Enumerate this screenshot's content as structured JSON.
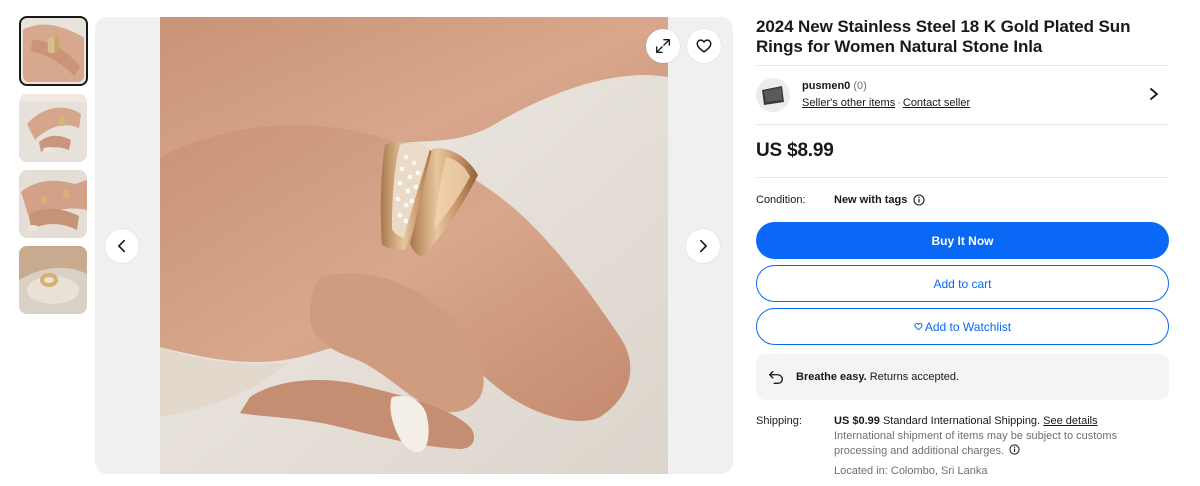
{
  "product": {
    "title": "2024 New Stainless Steel 18 K Gold Plated Sun Rings for Women Natural Stone Inla",
    "price": "US $8.99"
  },
  "gallery": {
    "thumbnails": [
      "ring-on-finger-closeup",
      "ring-hand-on-fabric",
      "rings-on-hand",
      "ring-on-fingertip"
    ],
    "active_index": 0
  },
  "seller": {
    "name": "pusmen0",
    "feedback": "(0)",
    "other_items_link": "Seller's other items",
    "separator": "·",
    "contact_link": "Contact seller"
  },
  "condition": {
    "label": "Condition:",
    "value": "New with tags"
  },
  "buttons": {
    "buy_now": "Buy It Now",
    "add_to_cart": "Add to cart",
    "watchlist": "Add to Watchlist"
  },
  "returns": {
    "bold": "Breathe easy.",
    "text": "Returns accepted."
  },
  "shipping": {
    "label": "Shipping:",
    "cost": "US $0.99",
    "method": "Standard International Shipping.",
    "details_link": "See details",
    "note": "International shipment of items may be subject to customs processing and additional charges.",
    "location": "Located in: Colombo, Sri Lanka"
  },
  "colors": {
    "primary_blue": "#0968f6",
    "text": "#191919",
    "muted": "#707070",
    "panel_bg": "#f4f4f4"
  },
  "icons": [
    "expand-icon",
    "heart-icon",
    "chevron-left-icon",
    "chevron-right-icon",
    "info-icon",
    "returns-icon"
  ]
}
